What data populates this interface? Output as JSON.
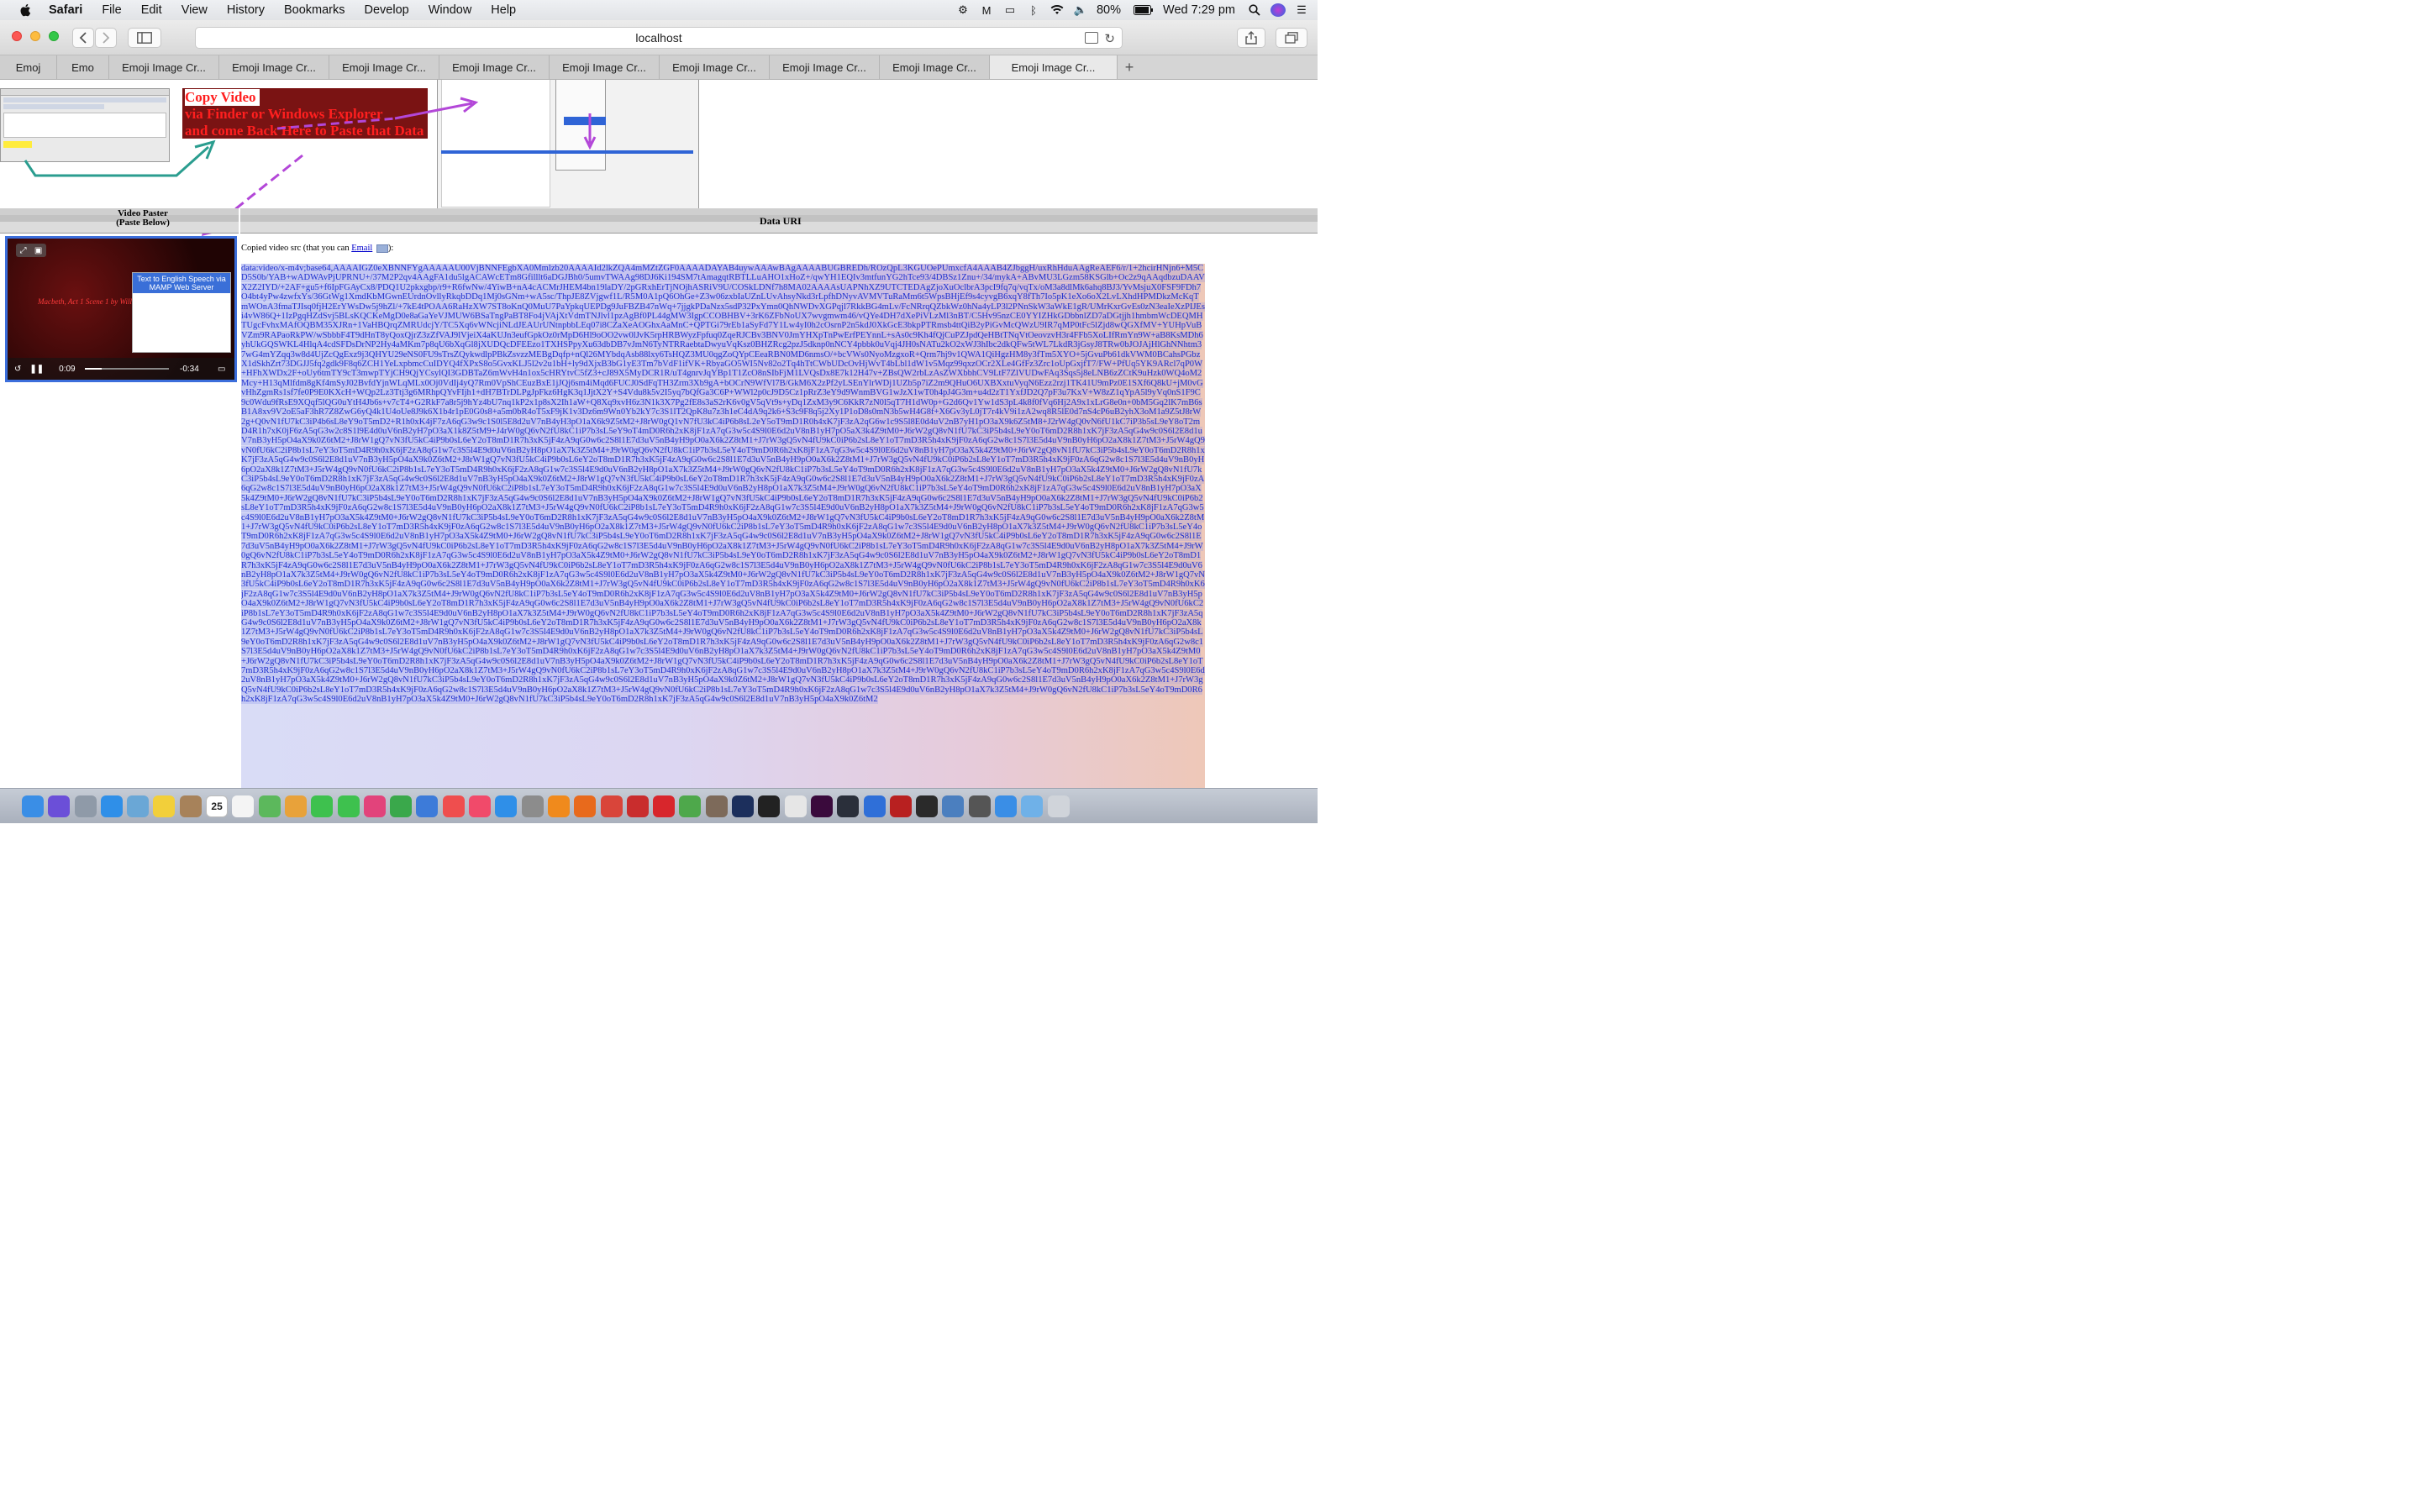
{
  "menubar": {
    "app_name": "Safari",
    "items": [
      "File",
      "Edit",
      "View",
      "History",
      "Bookmarks",
      "Develop",
      "Window",
      "Help"
    ],
    "battery": "80%",
    "clock": "Wed 7:29 pm"
  },
  "toolbar": {
    "url": "localhost",
    "back_icon": "chevron-left-icon",
    "forward_icon": "chevron-right-icon"
  },
  "tabs": [
    {
      "label": "Emoj"
    },
    {
      "label": "Emo"
    },
    {
      "label": "Emoji Image Cr..."
    },
    {
      "label": "Emoji Image Cr..."
    },
    {
      "label": "Emoji Image Cr..."
    },
    {
      "label": "Emoji Image Cr..."
    },
    {
      "label": "Emoji Image Cr..."
    },
    {
      "label": "Emoji Image Cr..."
    },
    {
      "label": "Emoji Image Cr..."
    },
    {
      "label": "Emoji Image Cr..."
    },
    {
      "label": "Emoji Image Cr..."
    }
  ],
  "active_tab_index": 10,
  "content": {
    "copy_instructions": {
      "line1": "Copy Video",
      "line2": "via Finder or Windows Explorer",
      "line3": "and come Back Here to Paste that Data"
    },
    "video_paster_label_1": "Video Paster",
    "video_paster_label_2": "(Paste Below)",
    "data_uri_label": "Data URI",
    "copied_label_prefix": "Copied video src (that you can ",
    "copied_label_link": "Email",
    "copied_label_suffix": "):",
    "video": {
      "time_elapsed": "0:09",
      "time_remaining": "-0:34",
      "progress": 0.2,
      "inset_title": "Text to English Speech via MAMP Web Server",
      "title_text": "Macbeth, Act 1 Scene 1 by William Shakespeare"
    },
    "data_uri_text": "data:video/x-m4v;base64,AAAAIGZ0eXBNNFYgAAAAAU00VjBNNFEgbXA0Mmlzb20AAAAId2lkZQA4mMZtZGF0AAAADAYAB4uywAAAwBAgAAAABUGBREDh/ROzQpL3KGUOePUmxcfA4AAAB4ZJbggH/uxRhHduAAgReAEF6/r/1+2hcirHNjn6+M5CD5S0b/YAB+wADWAvPjUPRNU+/37M2P2qv4AAgFA1du5lgACAWcETm8Gfilllt6aDGJBh0/5umvTWAAg98DJ6Ki194SM7tAmagqtRBTLLuAHO1xHoZ+/qwYH1EQIv3mtfunYG2hTce93/4DBSz1Znu+/34/mykA+ABvMU3LGzm58KSGlb+Oc2z9qAAqdbzuDAAVX2Z2IYD/+2AF+gu5+f6IpFGAyCx8/PDQ1U2pkxgbp/r9+R6fwNw/4YiwB+nA4cACMrJHEM4bn19laDY/2pGRxhErTjNOjhASRiV9U/COSkLDNf7h8MA02AAAAsUAPNhXZ9UTCTEDAgZjoXuOclbrA3pcI9fq7q/vqTx/oM3a8dlMk6ahq8BJ3/YvMsjuX0FSF9FDh7O4bt4yPw4zwfxYs/36GtWg1XmdKbMGwnEUrdnOvllyRkqbDDq1Mj0sGNm+wA5sc/ThpJE8ZVjgwf1L/R5M0A1pQ6OhGe+Z3w06zxbIaUZnLUvAhsyNkd3rLpfhDNyvAVMVTuRaMm6t5WpsBHjEf9s4cyvgB6xqY8fTh7Io5pK1eXo6oX2LvLXhdHPMDkzMcKqTmWOnA3fmaTJIsq0fjH2ErYWsDw5j9hZl/+7kE4tPOAA6RaHzXW7ST8oKnQ0MuU7PaYpkqUEPDg9JuFBZB47nWq+7jjgkPDaNzx5sdP32PxYmn0QhNWDvXGPqjl7RkkBG4mLv/FcNRrqQZbkWz0hNa4yLP3l2PNnSkW3aWkE1gR/UMrKxrGvEs0zN3eaIeXzPIJEsi4vW86Q+1IzPgqHZdSvj5BLsKQCKeMgD0e8aGaYeVJMUW6BSaTngPaBT8Fo4jVAjXtVdmTNJlvl1pzAgBf0PL44gMW3IgpCCOBHBV+3rK6ZFbNoUX7wvgmwm46/vQYe4DH7dXePiVLzMl3nBT/C5Hv95nzCE0YYIZHkGDbbnlZD7aDGtjjh1hmbmWcDEQMHTUgcFvhxMAfOQBM35XJRn+1VaHBQrqZMRUdcjY/TC5Xq6vWNcjiNLdJEAUrUNtnpbbLEq07i8CZaXeAOGhxAaMnC+QPTGi79rEb1aSyFd7Y1Lw4yI0h2cOsrnP2n5kdJ0XkGcE3bkpPTRmsb4ttQiB2yPiGvMcQWzU9IR7qMP0tFc5lZjd8wQGXfMV+YUHpVuBVZm9RAPaoRkPW/wSbbbF4T9dHnT8yQoxQjrZ3zZfVAJ9lVjeiX4aKUJn3eufGpkOz0rMpD6Hl9oOO2vw0lJvK5rpHRBWyzFpfuq0ZqeRJCBv3BNV0JmYHXpTnPwErfPEYnnL+sAs0c9Kh4fQjCuPZJpdQeHBtTNqVtOeovzvH3r4FFb5XoLIfRmYn9W+aB8KsMDh6yhUkGQSWKL4HlqA4cdSFDsDrNP2Hy4aMKm7p8qU6bXqGl8jXUDQcDFEEzo1TXHSPpyXu63dbDB7vJmN6TyNTRRaebtaDwyuVqKsz0BHZRcg2pzJ5dknp0nNCY4pbbk0uVqj4JH0sNATu2kO2xWJ3hIbc2dkQFw5tWL7LkdR3jGsyJ8TRw0bJOJAjHlGhNNhtm37wG4mYZqq3w8d4UjZcQgExz9j3QHYU29eNS0FU9sTrsZQykwdlpPBkZsvzzMEBgDqfp+nQl26MYbdqAsb88lxy6TsHQZ3MU0qgZoQYpCEeaRBN0MD6nmsO/+bcVWs0NyoMzgxoR+Qrm7hj9v1QWA1QiHgzHM8y3fTm5XYO+5jGvuPb61dkVWM0BCahsPGbzX1dSkhZrt73DGJJ5fq2gdk9F8q6ZCH1YeLxpbmcCuIDYQ4fXPxS8o5GvxKLJ5l2v2u1bH+ly9dXjxB3bG1yE3Tm7bVdF1ifVK+RbyaGO5WI5Nv82o2Tq4hTtCWbUDcOvHjWvT4bLbl1dW1v5Mqz99qxzOCr2XLe4GfFz3Zrc1oUpGxjfT7/FW+PfUq5YK9ARcl7qP0W+HFhXWDx2F+oUy6tmTY9cT3mwpTYjCH9QjYCsylQI3GDBTaZ6mWvH4n1ox5cHRYtvC5fZ3+cJ89X5MyDCR1R/uT4gnrvJqYBp1T1ZcO8nSIbFjM1LVQsDx8E7k12H47v+ZBsQW2rbLzAsZWXbbhCV9LtF7ZlVUDwFAq3Sqs5j8eLNB6zZCtK9uHzk0WQ4oM2Mcy+H13qMlfdm8gKf4mSyJ02BvfdYjnWLqMLx0Oj0VdIj4yQ7Rm0VpShCEuzBxE1jJQj6sm4iMqd6FUCJ0SdFqTH3Zrm3Xb9gA+bOCrN9WfVl7B/GkM6X2zPf2yLSEnYlrWDj1UZb5p7iZ2m9QHuO6UXBXxtuVyqN6Ezz2rzj1TK41U9mPz0E1SXf6Q8kU+jM0vGvHhZgmRs1sf7fe0P9E0KXcH+WQp2Lz3Ttj3g6MRhpQYvFIjh1+dH7BTrDLPgJpFkz6HgK3q1JjtX2Y+S4Vdu8k5v2I5yq7bQfGa3C6P+WWl2p0cJ9D5Cz1pRrZ3eY9d9WnmBVG1wJzX1wT0h4pJ4G3m+u4d2zT1YxfJD2Q7pF3u7KxV+W8zZ1qYpA5l9yVq0nS1F9C9c0Wdu9fRsE9XQqf5lQG0uYtH4Jb6s+v7cT4+G2RkF7a8r5j9hYz4bU7nq1kP2x1p8sX2Ih1aW+Q8Xq9xvH6z3N1k3X7Pg2fE8s3aS2rK6v0gV5qVt9s+yDq1ZxM3y9C6KkR7zN0l5qT7H1dW0p+G2d6Qv1Yw1dS3pL4k8f0fVq6Hj2A9x1xLrG8e0n+0bM5Gq2lK7mB6sB1A8xv9V2oE5aF3hR7Z8ZwG6yQ4k1U4oUe8J9k6X1b4r1pE0G0s8+a5m0bR4oT5xF9jK1v3Dz6m9Wn0Yb2kY7c3S1lT2QpK8u7z3h1eC4dA9q2k6+S3c9F8q5j2Xy1P1oD8s0mN3b5wH4G8f+X6Gv3yL0jT7r4kV9i1zA2wq8R5lE0d7nS4cP6uB2yhX3oM1a9Z5tJ8rW2g+Q0vN1fU7kC3iP4b6sL8eY9oT5mD2+R1h0xK4jF7zA6qG3w9c1S0l5E8d2uV7nB4yH3pO1aX6k9Z5tM2+J8rW0gQ1vN7fU3kC4iP6b8sL2eY5oT9mD1R0h4xK7jF3zA2qG6w1c9S5l8E0d4uV2nB7yH1pO3aX9k6Z5tM8+J2rW4gQ0vN6fU1kC7iP3b5sL9eY8oT2mD4R1h7xK0jF6zA5qG3w2c8S1l9E4d0uV6nB2yH7pO3aX1k8Z5tM9+J4rW0gQ6vN2fU8kC1iP7b3sL5eY9oT4mD0R6h2xK8jF1zA7qG3w5c4S9l0E6d2uV8nB1yH7pO5aX3k4Z9tM0+J6rW2gQ8vN1fU7kC3iP5b4sL9eY0oT6mD2R8h1xK7jF3zA5qG4w9c0S6l2E8d1uV7nB3yH5pO4aX9k0Z6tM2+J8rW1gQ7vN3fU5kC4iP9b0sL6eY2oT8mD1R7h3xK5jF4zA9qG0w6c2S8l1E7d3uV5nB4yH9pO0aX6k2Z8tM1+J7rW3gQ5vN4fU9kC0iP6b2sL8eY1oT7mD3R5h4xK9jF0zA6qG2w8c1S7l3E5d4uV9nB0yH6pO2aX8k1Z7tM3+J5rW4gQ9vN0fU6kC2iP8b1sL7eY3oT5mD4R9h0xK6jF2zA8qG1w7c3S5l4E9d0uV6nB2yH8pO1aX7k3Z5tM4+J9rW0gQ6vN2fU8kC1iP7b3sL5eY4oT9mD0R6h2xK8jF1zA7qG3w5c4S9l0E6d2uV8nB1yH7pO3aX5k4Z9tM0+J6rW2gQ8vN1fU7kC3iP5b4sL9eY0oT6mD2R8h1xK7jF3zA5qG4w9c0S6l2E8d1uV7nB3yH5pO4aX9k0Z6tM2+J8rW1gQ7vN3fU5kC4iP9b0sL6eY2oT8mD1R7h3xK5jF4zA9qG0w6c2S8l1E7d3uV5nB4yH9pO0aX6k2Z8tM1+J7rW3gQ5vN4fU9kC0iP6b2sL8eY1oT7mD3R5h4xK9jF0zA6qG2w8c1S7l3E5d4uV9nB0yH6pO2aX8k1Z7tM3+J5rW4gQ9vN0fU6kC2iP8b1sL7eY3oT5mD4R9h0xK6jF2zA8qG1w7c3S5l4E9d0uV6nB2yH8pO1aX7k3Z5tM4+J9rW0gQ6vN2fU8kC1iP7b3sL5eY4oT9mD0R6h2xK8jF1zA7qG3w5c4S9l0E6d2uV8nB1yH7pO3aX5k4Z9tM0+J6rW2gQ8vN1fU7kC3iP5b4sL9eY0oT6mD2R8h1xK7jF3zA5qG4w9c0S6l2E8d1uV7nB3yH5pO4aX9k0Z6tM2+J8rW1gQ7vN3fU5kC4iP9b0sL6eY2oT8mD1R7h3xK5jF4zA9qG0w6c2S8l1E7d3uV5nB4yH9pO0aX6k2Z8tM1+J7rW3gQ5vN4fU9kC0iP6b2sL8eY1oT7mD3R5h4xK9jF0zA6qG2w8c1S7l3E5d4uV9nB0yH6pO2aX8k1Z7tM3+J5rW4gQ9vN0fU6kC2iP8b1sL7eY3oT5mD4R9h0xK6jF2zA8qG1w7c3S5l4E9d0uV6nB2yH8pO1aX7k3Z5tM4+J9rW0gQ6vN2fU8kC1iP7b3sL5eY4oT9mD0R6h2xK8jF1zA7qG3w5c4S9l0E6d2uV8nB1yH7pO3aX5k4Z9tM0+J6rW2gQ8vN1fU7kC3iP5b4sL9eY0oT6mD2R8h1xK7jF3zA5qG4w9c0S6l2E8d1uV7nB3yH5pO4aX9k0Z6tM2+J8rW1gQ7vN3fU5kC4iP9b0sL6eY2oT8mD1R7h3xK5jF4zA9qG0w6c2S8l1E7d3uV5nB4yH9pO0aX6k2Z8tM1+J7rW3gQ5vN4fU9kC0iP6b2sL8eY1oT7mD3R5h4xK9jF0zA6qG2w8c1S7l3E5d4uV9nB0yH6pO2aX8k1Z7tM3+J5rW4gQ9vN0fU6kC2iP8b1sL7eY3oT5mD4R9h0xK6jF2zA8qG1w7c3S5l4E9d0uV6nB2yH8pO1aX7k3Z5tM4+J9rW0gQ6vN2fU8kC1iP7b3sL5eY4oT9mD0R6h2xK8jF1zA7qG3w5c4S9l0E6d2uV8nB1yH7pO3aX5k4Z9tM0+J6rW2gQ8vN1fU7kC3iP5b4sL9eY0oT6mD2R8h1xK7jF3zA5qG4w9c0S6l2E8d1uV7nB3yH5pO4aX9k0Z6tM2+J8rW1gQ7vN3fU5kC4iP9b0sL6eY2oT8mD1R7h3xK5jF4zA9qG0w6c2S8l1E7d3uV5nB4yH9pO0aX6k2Z8tM1+J7rW3gQ5vN4fU9kC0iP6b2sL8eY1oT7mD3R5h4xK9jF0zA6qG2w8c1S7l3E5d4uV9nB0yH6pO2aX8k1Z7tM3+J5rW4gQ9vN0fU6kC2iP8b1sL7eY3oT5mD4R9h0xK6jF2zA8qG1w7c3S5l4E9d0uV6nB2yH8pO1aX7k3Z5tM4+J9rW0gQ6vN2fU8kC1iP7b3sL5eY4oT9mD0R6h2xK8jF1zA7qG3w5c4S9l0E6d2uV8nB1yH7pO3aX5k4Z9tM0+J6rW2gQ8vN1fU7kC3iP5b4sL9eY0oT6mD2R8h1xK7jF3zA5qG4w9c0S6l2E8d1uV7nB3yH5pO4aX9k0Z6tM2+J8rW1gQ7vN3fU5kC4iP9b0sL6eY2oT8mD1R7h3xK5jF4zA9qG0w6c2S8l1E7d3uV5nB4yH9pO0aX6k2Z8tM1+J7rW3gQ5vN4fU9kC0iP6b2sL8eY1oT7mD3R5h4xK9jF0zA6qG2w8c1S7l3E5d4uV9nB0yH6pO2aX8k1Z7tM3+J5rW4gQ9vN0fU6kC2iP8b1sL7eY3oT5mD4R9h0xK6jF2zA8qG1w7c3S5l4E9d0uV6nB2yH8pO1aX7k3Z5tM4+J9rW0gQ6vN2fU8kC1iP7b3sL5eY4oT9mD0R6h2xK8jF1zA7qG3w5c4S9l0E6d2uV8nB1yH7pO3aX5k4Z9tM0+J6rW2gQ8vN1fU7kC3iP5b4sL9eY0oT6mD2R8h1xK7jF3zA5qG4w9c0S6l2E8d1uV7nB3yH5pO4aX9k0Z6tM2+J8rW1gQ7vN3fU5kC4iP9b0sL6eY2oT8mD1R7h3xK5jF4zA9qG0w6c2S8l1E7d3uV5nB4yH9pO0aX6k2Z8tM1+J7rW3gQ5vN4fU9kC0iP6b2sL8eY1oT7mD3R5h4xK9jF0zA6qG2w8c1S7l3E5d4uV9nB0yH6pO2aX8k1Z7tM3+J5rW4gQ9vN0fU6kC2iP8b1sL7eY3oT5mD4R9h0xK6jF2zA8qG1w7c3S5l4E9d0uV6nB2yH8pO1aX7k3Z5tM4+J9rW0gQ6vN2fU8kC1iP7b3sL5eY4oT9mD0R6h2xK8jF1zA7qG3w5c4S9l0E6d2uV8nB1yH7pO3aX5k4Z9tM0+J6rW2gQ8vN1fU7kC3iP5b4sL9eY0oT6mD2R8h1xK7jF3zA5qG4w9c0S6l2E8d1uV7nB3yH5pO4aX9k0Z6tM2+J8rW1gQ7vN3fU5kC4iP9b0sL6eY2oT8mD1R7h3xK5jF4zA9qG0w6c2S8l1E7d3uV5nB4yH9pO0aX6k2Z8tM1+J7rW3gQ5vN4fU9kC0iP6b2sL8eY1oT7mD3R5h4xK9jF0zA6qG2w8c1S7l3E5d4uV9nB0yH6pO2aX8k1Z7tM3+J5rW4gQ9vN0fU6kC2iP8b1sL7eY3oT5mD4R9h0xK6jF2zA8qG1w7c3S5l4E9d0uV6nB2yH8pO1aX7k3Z5tM4+J9rW0gQ6vN2fU8kC1iP7b3sL5eY4oT9mD0R6h2xK8jF1zA7qG3w5c4S9l0E6d2uV8nB1yH7pO3aX5k4Z9tM0+J6rW2gQ8vN1fU7kC3iP5b4sL9eY0oT6mD2R8h1xK7jF3zA5qG4w9c0S6l2E8d1uV7nB3yH5pO4aX9k0Z6tM2+J8rW1gQ7vN3fU5kC4iP9b0sL6eY2oT8mD1R7h3xK5jF4zA9qG0w6c2S8l1E7d3uV5nB4yH9pO0aX6k2Z8tM1+J7rW3gQ5vN4fU9kC0iP6b2sL8eY1oT7mD3R5h4xK9jF0zA6qG2w8c1S7l3E5d4uV9nB0yH6pO2aX8k1Z7tM3+J5rW4gQ9vN0fU6kC2iP8b1sL7eY3oT5mD4R9h0xK6jF2zA8qG1w7c3S5l4E9d0uV6nB2yH8pO1aX7k3Z5tM4+J9rW0gQ6vN2fU8kC1iP7b3sL5eY4oT9mD0R6h2xK8jF1zA7qG3w5c4S9l0E6d2uV8nB1yH7pO3aX5k4Z9tM0+J6rW2gQ8vN1fU7kC3iP5b4sL9eY0oT6mD2R8h1xK7jF3zA5qG4w9c0S6l2E8d1uV7nB3yH5pO4aX9k0Z6tM2+J8rW1gQ7vN3fU5kC4iP9b0sL6eY2oT8mD1R7h3xK5jF4zA9qG0w6c2S8l1E7d3uV5nB4yH9pO0aX6k2Z8tM1+J7rW3gQ5vN4fU9kC0iP6b2sL8eY1oT7mD3R5h4xK9jF0zA6qG2w8c1S7l3E5d4uV9nB0yH6pO2aX8k1Z7tM3+J5rW4gQ9vN0fU6kC2iP8b1sL7eY3oT5mD4R9h0xK6jF2zA8qG1w7c3S5l4E9d0uV6nB2yH8pO1aX7k3Z5tM4+J9rW0gQ6vN2fU8kC1iP7b3sL5eY4oT9mD0R6h2xK8jF1zA7qG3w5c4S9l0E6d2uV8nB1yH7pO3aX5k4Z9tM0+J6rW2gQ8vN1fU7kC3iP5b4sL9eY0oT6mD2R8h1xK7jF3zA5qG4w9c0S6l2E8d1uV7nB3yH5pO4aX9k0Z6tM2+J8rW1gQ7vN3fU5kC4iP9b0sL6eY2oT8mD1R7h3xK5jF4zA9qG0w6c2S8l1E7d3uV5nB4yH9pO0aX6k2Z8tM1+J7rW3gQ5vN4fU9kC0iP6b2sL8eY1oT7mD3R5h4xK9jF0zA6qG2w8c1S7l3E5d4uV9nB0yH6pO2aX8k1Z7tM3+J5rW4gQ9vN0fU6kC2iP8b1sL7eY3oT5mD4R9h0xK6jF2zA8qG1w7c3S5l4E9d0uV6nB2yH8pO1aX7k3Z5tM4+J9rW0gQ6vN2fU8kC1iP7b3sL5eY4oT9mD0R6h2xK8jF1zA7qG3w5c4S9l0E6d2uV8nB1yH7pO3aX5k4Z9tM0+J6rW2gQ8vN1fU7kC3iP5b4sL9eY0oT6mD2R8h1xK7jF3zA5qG4w9c0S6l2E8d1uV7nB3yH5pO4aX9k0Z6tM2+J8rW1gQ7vN3fU5kC4iP9b0sL6eY2oT8mD1R7h3xK5jF4zA9qG0w6c2S8l1E7d3uV5nB4yH9pO0aX6k2Z8tM1+J7rW3gQ5vN4fU9kC0iP6b2sL8eY1oT7mD3R5h4xK9jF0zA6qG2w8c1S7l3E5d4uV9nB0yH6pO2aX8k1Z7tM3+J5rW4gQ9vN0fU6kC2iP8b1sL7eY3oT5mD4R9h0xK6jF2zA8qG1w7c3S5l4E9d0uV6nB2yH8pO1aX7k3Z5tM4+J9rW0gQ6vN2fU8kC1iP7b3sL5eY4oT9mD0R6h2xK8jF1zA7qG3w5c4S9l0E6d2uV8nB1yH7pO3aX5k4Z9tM0+J6rW2gQ8vN1fU7kC3iP5b4sL9eY0oT6mD2R8h1xK7jF3zA5qG4w9c0S6l2E8d1uV7nB3yH5pO4aX9k0Z6tM2+J8rW1gQ7vN3fU5kC4iP9b0sL6eY2oT8mD1R7h3xK5jF4zA9qG0w6c2S8l1E7d3uV5nB4yH9pO0aX6k2Z8tM1+J7rW3gQ5vN4fU9kC0iP6b2sL8eY1oT7mD3R5h4xK9jF0zA6qG2w8c1S7l3E5d4uV9nB0yH6pO2aX8k1Z7tM3+J5rW4gQ9vN0fU6kC2iP8b1sL7eY3oT5mD4R9h0xK6jF2zA8qG1w7c3S5l4E9d0uV6nB2yH8pO1aX7k3Z5tM4+J9rW0gQ6vN2fU8kC1iP7b3sL5eY4oT9mD0R6h2xK8jF1zA7qG3w5c4S9l0E6d2uV8nB1yH7pO3aX5k4Z9tM0+J6rW2gQ8vN1fU7kC3iP5b4sL9eY0oT6mD2R8h1xK7jF3zA5qG4w9c0S6l2E8d1uV7nB3yH5pO4aX9k0Z6tM2"
  },
  "dock": {
    "calendar_day": "25",
    "icons": [
      {
        "name": "finder-icon",
        "color": "#3a8ee6"
      },
      {
        "name": "siri-icon",
        "color": "#6b4fd8"
      },
      {
        "name": "launchpad-icon",
        "color": "#8f9aa8"
      },
      {
        "name": "safari-icon",
        "color": "#2f8fe8"
      },
      {
        "name": "preview-icon",
        "color": "#6aa7d6"
      },
      {
        "name": "notes-icon",
        "color": "#f2cf3a"
      },
      {
        "name": "contacts-icon",
        "color": "#a7825a"
      },
      {
        "name": "calendar-icon",
        "color": "#ffffff"
      },
      {
        "name": "reminders-icon",
        "color": "#f4f4f4"
      },
      {
        "name": "maps-icon",
        "color": "#5cb85c"
      },
      {
        "name": "photos-icon",
        "color": "#e8a23a"
      },
      {
        "name": "facetime-icon",
        "color": "#3ec14e"
      },
      {
        "name": "messages-icon",
        "color": "#3ec14e"
      },
      {
        "name": "itunes-icon",
        "color": "#e2437b"
      },
      {
        "name": "numbers-icon",
        "color": "#3aa84b"
      },
      {
        "name": "keynote-icon",
        "color": "#3d7bd9"
      },
      {
        "name": "news-icon",
        "color": "#ef4e4e"
      },
      {
        "name": "music-icon",
        "color": "#f14a6a"
      },
      {
        "name": "appstore-icon",
        "color": "#2f8fe8"
      },
      {
        "name": "settings-icon",
        "color": "#8c8c8c"
      },
      {
        "name": "vlc-icon",
        "color": "#f08a1c"
      },
      {
        "name": "firefox-icon",
        "color": "#e86a1c"
      },
      {
        "name": "chrome-icon",
        "color": "#d9453a"
      },
      {
        "name": "filezilla-icon",
        "color": "#c92d2d"
      },
      {
        "name": "opera-icon",
        "color": "#d8262c"
      },
      {
        "name": "evernote-icon",
        "color": "#4ea84b"
      },
      {
        "name": "gimp-icon",
        "color": "#7d6a5a"
      },
      {
        "name": "photoshop-icon",
        "color": "#1c2f5c"
      },
      {
        "name": "terminal-icon",
        "color": "#222222"
      },
      {
        "name": "textedit-icon",
        "color": "#e6e6e6"
      },
      {
        "name": "xd-icon",
        "color": "#3a0a3c"
      },
      {
        "name": "dreamweaver-icon",
        "color": "#2a2f3a"
      },
      {
        "name": "xcode-icon",
        "color": "#2f6fd8"
      },
      {
        "name": "filezilla2-icon",
        "color": "#b82020"
      },
      {
        "name": "font-icon",
        "color": "#2a2a2a"
      },
      {
        "name": "network-icon",
        "color": "#4b7fbf"
      },
      {
        "name": "activity-icon",
        "color": "#555555"
      },
      {
        "name": "downloads-icon",
        "color": "#3a8ee6"
      },
      {
        "name": "folder-icon",
        "color": "#6fb1e8"
      },
      {
        "name": "trash-icon",
        "color": "#d0d4da"
      }
    ]
  }
}
